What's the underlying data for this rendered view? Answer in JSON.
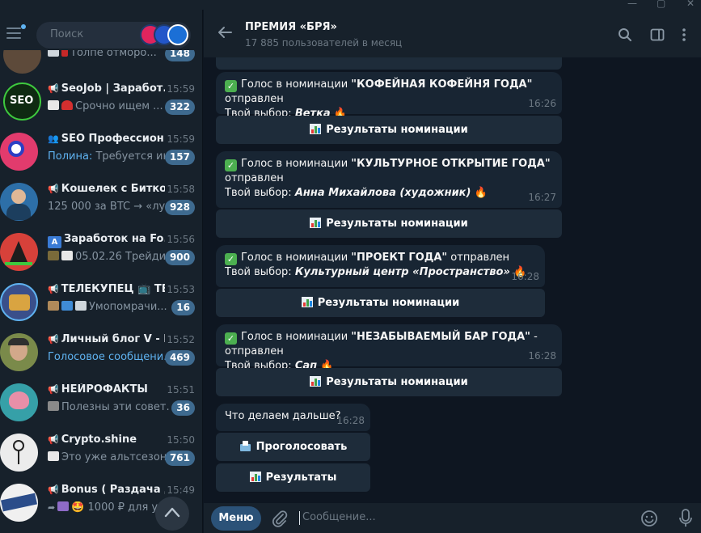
{
  "window": {
    "colors": {
      "sidebar": "#17212b",
      "chat_bg": "#0e1621",
      "bubble": "#182533",
      "accent": "#5fb2f0",
      "badge": "#3e6a8f",
      "menu_button": "#2b5278"
    }
  },
  "sidebar": {
    "search_placeholder": "Поиск",
    "chats": [
      {
        "title": "",
        "preview_text": "Толпе отморо...",
        "time": "",
        "unread": "148",
        "avatar_color": "#5d4a3a"
      },
      {
        "title": "SeoJob | Заработ...",
        "preview_text": "Срочно ищем ...",
        "time": "15:59",
        "unread": "322",
        "avatar_color": "#1a3a1a"
      },
      {
        "title": "SEO Профессион...",
        "preview_sender": "Полина:",
        "preview_text": " Требуется ин...",
        "time": "15:59",
        "unread": "157",
        "avatar_color": "#e23b6d"
      },
      {
        "title": "Кошелек с Битко...",
        "preview_text": "125 000 за BTC → «луч...",
        "time": "15:58",
        "unread": "928",
        "avatar_color": "#2d6fa8"
      },
      {
        "title": "Заработок на Fo...",
        "preview_text": "05.02.26 Трейди...",
        "time": "15:56",
        "unread": "900",
        "avatar_color": "#d7413a"
      },
      {
        "title": "ТЕЛЕКУПЕЦ 📺 ТВ...",
        "preview_text": "Умопомрачи...",
        "time": "15:53",
        "unread": "16",
        "avatar_color": "#3a4f8a"
      },
      {
        "title": "Личный блог V - Б...",
        "preview_text": "Голосовое сообщени...",
        "time": "15:52",
        "unread": "469",
        "avatar_color": "#7a8a4a"
      },
      {
        "title": "НЕЙРОФАКТЫ",
        "preview_text": "Полезны эти совет...",
        "time": "15:51",
        "unread": "36",
        "avatar_color": "#36a0a8"
      },
      {
        "title": "Crypto.shine",
        "preview_text": "Это уже альтсезон...",
        "time": "15:50",
        "unread": "761",
        "avatar_color": "#e8e8e8"
      },
      {
        "title": "Bonus ( Раздача д...",
        "preview_text": "🤩 1000 ₽ для у...",
        "time": "15:49",
        "unread": "",
        "avatar_color": "#f0f0f0"
      }
    ]
  },
  "header": {
    "title": "ПРЕМИЯ «БРЯ»",
    "subtitle": "17 885 пользователей в месяц"
  },
  "messages": [
    {
      "vote_prefix": "Голос в номинации ",
      "category": "\"КОФЕЙНАЯ КОФЕЙНЯ ГОДА\"",
      "sent": " отправлен",
      "choice_label": "Твой выбор: ",
      "choice": "Ветка",
      "time": "16:26",
      "button": "Результаты номинации"
    },
    {
      "vote_prefix": "Голос в номинации ",
      "category": "\"КУЛЬТУРНОЕ ОТКРЫТИЕ ГОДА\"",
      "sent": "отправлен",
      "choice_label": "Твой выбор: ",
      "choice": "Анна Михайлова (художник)",
      "time": "16:27",
      "button": "Результаты номинации"
    },
    {
      "vote_prefix": "Голос в номинации ",
      "category": "\"ПРОЕКТ ГОДА\"",
      "sent": " отправлен",
      "choice_label": "Твой выбор: ",
      "choice": "Культурный центр «Пространство»",
      "time": "16:28",
      "button": "Результаты номинации"
    },
    {
      "vote_prefix": "Голос в номинации ",
      "category": "\"НЕЗАБЫВАЕМЫЙ БАР ГОДА\"",
      "sent": " - отправлен",
      "choice_label": "Твой выбор: ",
      "choice": "Сап",
      "time": "16:28",
      "button": "Результаты номинации"
    }
  ],
  "final_message": {
    "text": "Что делаем дальше?",
    "time": "16:28",
    "vote_button": "Проголосовать",
    "results_button": "Результаты"
  },
  "composer": {
    "menu_label": "Меню",
    "placeholder": "Сообщение..."
  }
}
